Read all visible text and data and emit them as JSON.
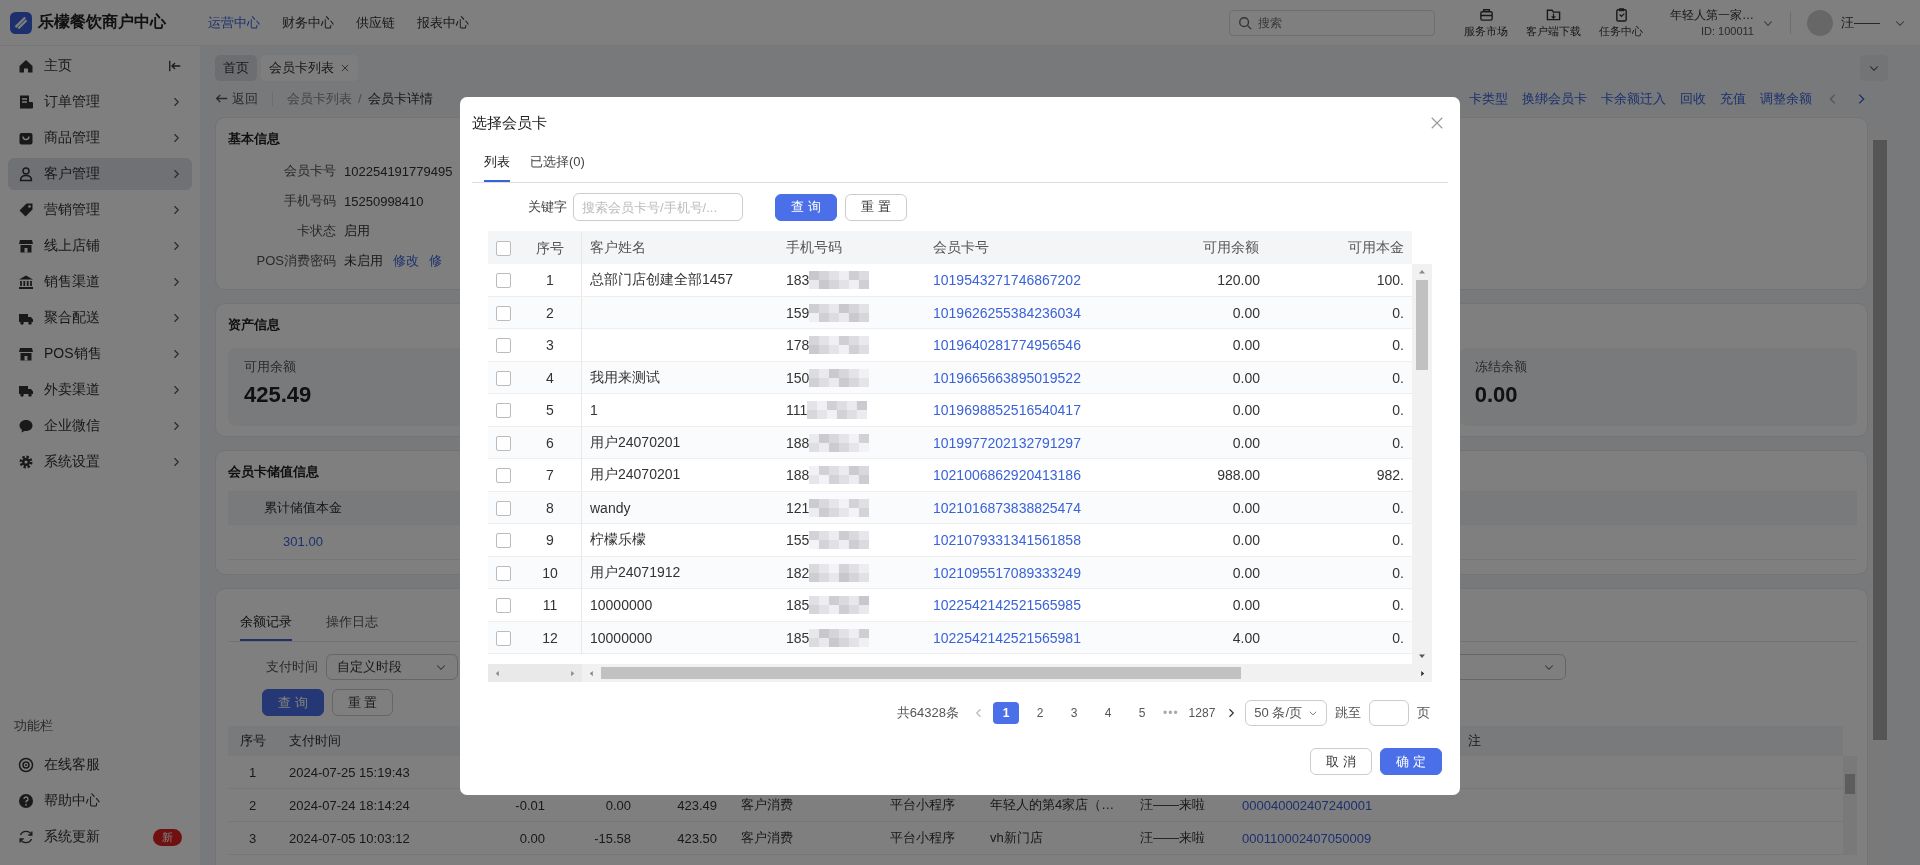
{
  "top_bar": {
    "logo": "乐檬餐饮商户中心",
    "nav": [
      {
        "label": "运营中心",
        "selected": true
      },
      {
        "label": "财务中心",
        "selected": false
      },
      {
        "label": "供应链",
        "selected": false
      },
      {
        "label": "报表中心",
        "selected": false
      }
    ],
    "search": {
      "placeholder": "搜索"
    },
    "tools": [
      "服务市场",
      "客户端下载",
      "任务中心"
    ],
    "account": {
      "name": "年轻人第一家…",
      "id": "ID: 100011"
    },
    "user": "汪——"
  },
  "sidebar": {
    "items": [
      {
        "label": "主页",
        "selected": false
      },
      {
        "label": "订单管理",
        "selected": false
      },
      {
        "label": "商品管理",
        "selected": false
      },
      {
        "label": "客户管理",
        "selected": true
      },
      {
        "label": "营销管理",
        "selected": false
      },
      {
        "label": "线上店铺",
        "selected": false
      },
      {
        "label": "销售渠道",
        "selected": false
      },
      {
        "label": "聚合配送",
        "selected": false
      },
      {
        "label": "POS销售",
        "selected": false
      },
      {
        "label": "外卖渠道",
        "selected": false
      },
      {
        "label": "企业微信",
        "selected": false
      },
      {
        "label": "系统设置",
        "selected": false
      }
    ],
    "section_title": "功能栏",
    "footer": [
      {
        "label": "在线客服"
      },
      {
        "label": "帮助中心"
      },
      {
        "label": "系统更新",
        "badge": "新"
      }
    ]
  },
  "page_tabs": [
    {
      "label": "首页",
      "selected": false,
      "closable": false
    },
    {
      "label": "会员卡列表",
      "selected": true,
      "closable": true
    }
  ],
  "breadcrumb": {
    "back": "返回",
    "separator": "/",
    "items": [
      "会员卡列表",
      "会员卡详情"
    ]
  },
  "actions": [
    "卡类型",
    "换绑会员卡",
    "卡余额迁入",
    "回收",
    "充值",
    "调整余额"
  ],
  "basic_info": {
    "title": "基本信息",
    "fields": [
      {
        "label": "会员卡号",
        "value": "102254191779495"
      },
      {
        "label": "手机号码",
        "value": "15250998410"
      },
      {
        "label": "卡状态",
        "value": "启用"
      },
      {
        "label": "POS消费密码",
        "value": "未启用",
        "links": [
          "修改",
          "修"
        ]
      }
    ]
  },
  "asset_info": {
    "title": "资产信息",
    "stats": [
      {
        "label": "可用余额",
        "value": "425.49"
      },
      {
        "label": "冻结余额",
        "value": "0.00"
      }
    ]
  },
  "stored_value": {
    "title": "会员卡储值信息",
    "columns": [
      "累计储值本金"
    ],
    "values": [
      "301.00"
    ]
  },
  "records": {
    "tabs": [
      {
        "label": "余额记录",
        "selected": true
      },
      {
        "label": "操作日志",
        "selected": false
      }
    ],
    "filter_label": "支付时间",
    "range_type": "自定义时段",
    "buttons": [
      "查 询",
      "重 置"
    ],
    "columns": [
      "序号",
      "支付时间"
    ],
    "remark_column": "注",
    "rows": [
      {
        "no": "1",
        "time": "2024-07-25 15:19:43"
      },
      {
        "no": "2",
        "time": "2024-07-24 18:14:24",
        "column_3": "-0.01",
        "column_4": "0.00",
        "column_5": "423.49",
        "column_6": "客户消费",
        "column_7": "平台小程序",
        "column_8": "年轻人的第4家店（…",
        "column_9": "汪——来啦",
        "column_10": "000040002407240001"
      },
      {
        "no": "3",
        "time": "2024-07-05 10:03:12",
        "column_3": "0.00",
        "column_4": "-15.58",
        "column_5": "423.50",
        "column_6": "客户消费",
        "column_7": "平台小程序",
        "column_8": "vh新门店",
        "column_9": "汪——来啦",
        "column_10": "000110002407050009"
      }
    ]
  },
  "modal": {
    "title": "选择会员卡",
    "tabs": [
      {
        "label": "列表",
        "selected": true
      },
      {
        "label": "已选择(0)",
        "selected": false
      }
    ],
    "keyword_label": "关键字",
    "keyword": {
      "placeholder": "搜索会员卡号/手机号/..."
    },
    "buttons": [
      "查 询",
      "重 置"
    ],
    "table": {
      "all_checked": false,
      "columns": [
        "序号",
        "客户姓名",
        "手机号码",
        "会员卡号",
        "可用余额",
        "可用本金"
      ],
      "rows": [
        {
          "checked": false,
          "no": "1",
          "name": "总部门店创建全部1457",
          "phone": "183",
          "card_no": "1019543271746867202",
          "balance": "120.00",
          "principal": "100."
        },
        {
          "checked": false,
          "no": "2",
          "phone": "159",
          "card_no": "1019626255384236034",
          "balance": "0.00",
          "principal": "0."
        },
        {
          "checked": false,
          "no": "3",
          "phone": "178",
          "card_no": "1019640281774956546",
          "balance": "0.00",
          "principal": "0."
        },
        {
          "checked": false,
          "no": "4",
          "name": "我用来测试",
          "phone": "150",
          "card_no": "1019665663895019522",
          "balance": "0.00",
          "principal": "0."
        },
        {
          "checked": false,
          "no": "5",
          "name": "1",
          "phone": "111",
          "card_no": "1019698852516540417",
          "balance": "0.00",
          "principal": "0."
        },
        {
          "checked": false,
          "no": "6",
          "name": "用户24070201",
          "phone": "188",
          "card_no": "1019977202132791297",
          "balance": "0.00",
          "principal": "0."
        },
        {
          "checked": false,
          "no": "7",
          "name": "用户24070201",
          "phone": "188",
          "card_no": "1021006862920413186",
          "balance": "988.00",
          "principal": "982."
        },
        {
          "checked": false,
          "no": "8",
          "name": "wandy",
          "phone": "121",
          "card_no": "1021016873838825474",
          "balance": "0.00",
          "principal": "0."
        },
        {
          "checked": false,
          "no": "9",
          "name": "柠檬乐檬",
          "phone": "155",
          "card_no": "1021079331341561858",
          "balance": "0.00",
          "principal": "0."
        },
        {
          "checked": false,
          "no": "10",
          "name": "用户24071912",
          "phone": "182",
          "card_no": "1021095517089333249",
          "balance": "0.00",
          "principal": "0."
        },
        {
          "checked": false,
          "no": "11",
          "name": "10000000",
          "phone": "185",
          "card_no": "1022542142521565985",
          "balance": "0.00",
          "principal": "0."
        },
        {
          "checked": false,
          "no": "12",
          "name": "10000000",
          "phone": "185",
          "card_no": "1022542142521565981",
          "balance": "4.00",
          "principal": "0."
        }
      ]
    },
    "pagination": {
      "total": "共64328条",
      "prev_disabled": true,
      "pages": [
        {
          "kind": "page",
          "label": "1",
          "selected": true
        },
        {
          "kind": "page",
          "label": "2",
          "selected": false
        },
        {
          "kind": "page",
          "label": "3",
          "selected": false
        },
        {
          "kind": "page",
          "label": "4",
          "selected": false
        },
        {
          "kind": "page",
          "label": "5",
          "selected": false
        },
        {
          "kind": "ellipsis",
          "label": "•••"
        },
        {
          "kind": "page",
          "label": "1287",
          "selected": false
        }
      ],
      "page_size": "50 条/页",
      "jump_label": "跳至",
      "jump_suffix": "页"
    },
    "footer_buttons": [
      "取 消",
      "确 定"
    ]
  }
}
